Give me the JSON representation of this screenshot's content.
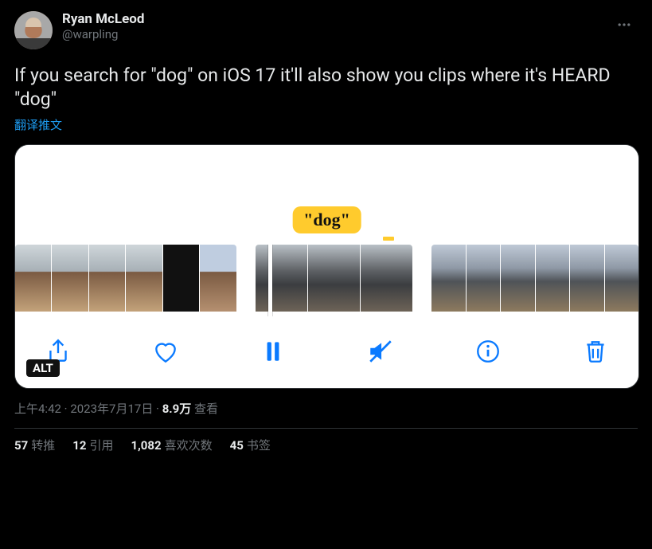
{
  "author": {
    "display_name": "Ryan McLeod",
    "handle": "@warpling"
  },
  "body_text": "If you search for \"dog\" on iOS 17 it'll also show you clips where it's HEARD \"dog\"",
  "translate_label": "翻译推文",
  "media": {
    "badge_text": "\"dog\"",
    "alt_label": "ALT",
    "toolbar_icons": [
      "share-icon",
      "heart-icon",
      "pause-icon",
      "mute-icon",
      "info-icon",
      "trash-icon"
    ]
  },
  "meta": {
    "time": "上午4:42",
    "date": "2023年7月17日",
    "views_value": "8.9万",
    "views_label": "查看",
    "separator": " · "
  },
  "stats": {
    "retweets": {
      "value": "57",
      "label": "转推"
    },
    "quotes": {
      "value": "12",
      "label": "引用"
    },
    "likes": {
      "value": "1,082",
      "label": "喜欢次数"
    },
    "bookmarks": {
      "value": "45",
      "label": "书签"
    }
  }
}
